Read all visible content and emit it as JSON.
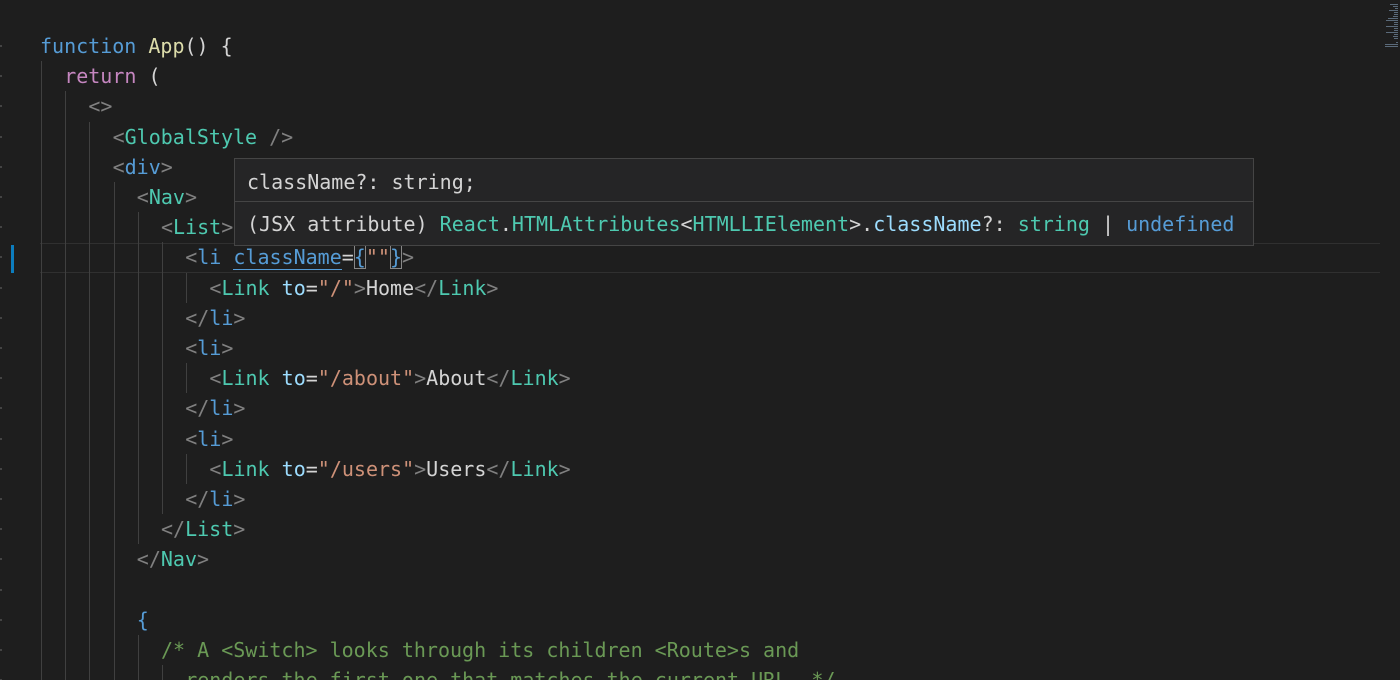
{
  "editor": {
    "lines": [
      {
        "tokens": [
          {
            "c": "kw",
            "t": "function"
          },
          {
            "c": "txt",
            "t": " "
          },
          {
            "c": "fn",
            "t": "App"
          },
          {
            "c": "txt",
            "t": "() {"
          }
        ]
      },
      {
        "tokens": [
          {
            "c": "ret",
            "t": "return"
          },
          {
            "c": "txt",
            "t": " ("
          }
        ]
      },
      {
        "tokens": [
          {
            "c": "punct",
            "t": "<>"
          }
        ]
      },
      {
        "tokens": [
          {
            "c": "punct",
            "t": "<"
          },
          {
            "c": "tag",
            "t": "GlobalStyle"
          },
          {
            "c": "txt",
            "t": " "
          },
          {
            "c": "punct",
            "t": "/>"
          }
        ]
      },
      {
        "tokens": [
          {
            "c": "punct",
            "t": "<"
          },
          {
            "c": "htmltag",
            "t": "div"
          },
          {
            "c": "punct",
            "t": ">"
          }
        ]
      },
      {
        "tokens": [
          {
            "c": "punct",
            "t": "<"
          },
          {
            "c": "tag",
            "t": "Nav"
          },
          {
            "c": "punct",
            "t": ">"
          }
        ]
      },
      {
        "tokens": [
          {
            "c": "punct",
            "t": "<"
          },
          {
            "c": "tag",
            "t": "List"
          },
          {
            "c": "punct",
            "t": ">"
          }
        ]
      },
      {
        "tokens": [
          {
            "c": "punct",
            "t": "<"
          },
          {
            "c": "htmltag",
            "t": "li"
          },
          {
            "c": "txt",
            "t": " "
          },
          {
            "c": "underline-attr",
            "t": "className"
          },
          {
            "c": "txt",
            "t": "="
          },
          {
            "c": "brace bracket-match",
            "t": "{"
          },
          {
            "c": "str",
            "t": "\"\""
          },
          {
            "c": "brace bracket-match",
            "t": "}"
          },
          {
            "c": "punct",
            "t": ">"
          }
        ]
      },
      {
        "tokens": [
          {
            "c": "punct",
            "t": "<"
          },
          {
            "c": "tag",
            "t": "Link"
          },
          {
            "c": "txt",
            "t": " "
          },
          {
            "c": "attr",
            "t": "to"
          },
          {
            "c": "txt",
            "t": "="
          },
          {
            "c": "str",
            "t": "\"/\""
          },
          {
            "c": "punct",
            "t": ">"
          },
          {
            "c": "txt",
            "t": "Home"
          },
          {
            "c": "punct",
            "t": "</"
          },
          {
            "c": "tag",
            "t": "Link"
          },
          {
            "c": "punct",
            "t": ">"
          }
        ]
      },
      {
        "tokens": [
          {
            "c": "punct",
            "t": "</"
          },
          {
            "c": "htmltag",
            "t": "li"
          },
          {
            "c": "punct",
            "t": ">"
          }
        ]
      },
      {
        "tokens": [
          {
            "c": "punct",
            "t": "<"
          },
          {
            "c": "htmltag",
            "t": "li"
          },
          {
            "c": "punct",
            "t": ">"
          }
        ]
      },
      {
        "tokens": [
          {
            "c": "punct",
            "t": "<"
          },
          {
            "c": "tag",
            "t": "Link"
          },
          {
            "c": "txt",
            "t": " "
          },
          {
            "c": "attr",
            "t": "to"
          },
          {
            "c": "txt",
            "t": "="
          },
          {
            "c": "str",
            "t": "\"/about\""
          },
          {
            "c": "punct",
            "t": ">"
          },
          {
            "c": "txt",
            "t": "About"
          },
          {
            "c": "punct",
            "t": "</"
          },
          {
            "c": "tag",
            "t": "Link"
          },
          {
            "c": "punct",
            "t": ">"
          }
        ]
      },
      {
        "tokens": [
          {
            "c": "punct",
            "t": "</"
          },
          {
            "c": "htmltag",
            "t": "li"
          },
          {
            "c": "punct",
            "t": ">"
          }
        ]
      },
      {
        "tokens": [
          {
            "c": "punct",
            "t": "<"
          },
          {
            "c": "htmltag",
            "t": "li"
          },
          {
            "c": "punct",
            "t": ">"
          }
        ]
      },
      {
        "tokens": [
          {
            "c": "punct",
            "t": "<"
          },
          {
            "c": "tag",
            "t": "Link"
          },
          {
            "c": "txt",
            "t": " "
          },
          {
            "c": "attr",
            "t": "to"
          },
          {
            "c": "txt",
            "t": "="
          },
          {
            "c": "str",
            "t": "\"/users\""
          },
          {
            "c": "punct",
            "t": ">"
          },
          {
            "c": "txt",
            "t": "Users"
          },
          {
            "c": "punct",
            "t": "</"
          },
          {
            "c": "tag",
            "t": "Link"
          },
          {
            "c": "punct",
            "t": ">"
          }
        ]
      },
      {
        "tokens": [
          {
            "c": "punct",
            "t": "</"
          },
          {
            "c": "htmltag",
            "t": "li"
          },
          {
            "c": "punct",
            "t": ">"
          }
        ]
      },
      {
        "tokens": [
          {
            "c": "punct",
            "t": "</"
          },
          {
            "c": "tag",
            "t": "List"
          },
          {
            "c": "punct",
            "t": ">"
          }
        ]
      },
      {
        "tokens": [
          {
            "c": "punct",
            "t": "</"
          },
          {
            "c": "tag",
            "t": "Nav"
          },
          {
            "c": "punct",
            "t": ">"
          }
        ]
      },
      {
        "tokens": []
      },
      {
        "tokens": [
          {
            "c": "brace",
            "t": "{"
          }
        ]
      },
      {
        "tokens": [
          {
            "c": "comment",
            "t": "/* A <Switch> looks through its children <Route>s and"
          }
        ]
      },
      {
        "tokens": [
          {
            "c": "comment",
            "t": "renders the first one that matches the current URL. */"
          }
        ]
      }
    ]
  },
  "hover": {
    "signature": "className?: string;",
    "detail": [
      {
        "c": "txt",
        "t": "(JSX attribute) "
      },
      {
        "c": "hv-cls",
        "t": "React"
      },
      {
        "c": "txt",
        "t": "."
      },
      {
        "c": "hv-cls",
        "t": "HTMLAttributes"
      },
      {
        "c": "txt",
        "t": "<"
      },
      {
        "c": "hv-type",
        "t": "HTMLLIElement"
      },
      {
        "c": "txt",
        "t": ">."
      },
      {
        "c": "hv-prop",
        "t": "className"
      },
      {
        "c": "txt",
        "t": "?: "
      },
      {
        "c": "hv-type",
        "t": "string"
      },
      {
        "c": "txt",
        "t": " | "
      },
      {
        "c": "hv-kw",
        "t": "undefined"
      }
    ]
  }
}
